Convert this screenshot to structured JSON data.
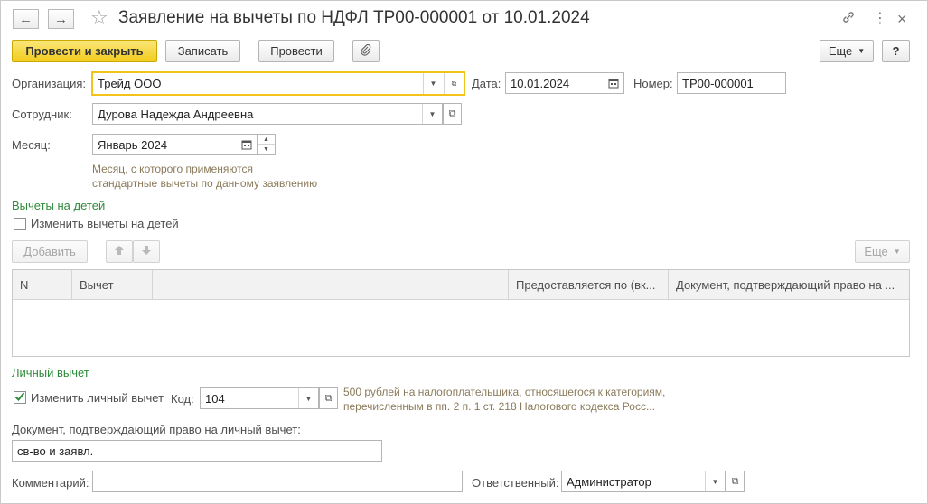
{
  "window": {
    "title": "Заявление на вычеты по НДФЛ ТР00-000001 от 10.01.2024",
    "back_icon": "←",
    "forward_icon": "→",
    "star_icon": "☆",
    "link_icon": "🔗",
    "more_icon": "⋮",
    "close_icon": "×"
  },
  "toolbar": {
    "post_close_label": "Провести и закрыть",
    "save_label": "Записать",
    "post_label": "Провести",
    "attach_icon": "📎",
    "more_label": "Еще",
    "help_label": "?"
  },
  "header": {
    "organization_label": "Организация:",
    "organization_value": "Трейд ООО",
    "date_label": "Дата:",
    "date_value": "10.01.2024",
    "number_label": "Номер:",
    "number_value": "ТР00-000001",
    "employee_label": "Сотрудник:",
    "employee_value": "Дурова Надежда Андреевна",
    "month_label": "Месяц:",
    "month_value": "Январь 2024",
    "month_hint_line1": "Месяц, с которого применяются",
    "month_hint_line2": "стандартные вычеты по данному заявлению"
  },
  "children": {
    "section_title": "Вычеты на детей",
    "change_label": "Изменить вычеты на детей",
    "change_checked": false,
    "add_label": "Добавить",
    "more_label": "Еще",
    "columns": [
      "N",
      "Вычет",
      "",
      "Предоставляется по (вк...",
      "Документ, подтверждающий право на ..."
    ]
  },
  "personal": {
    "section_title": "Личный вычет",
    "change_label": "Изменить личный вычет",
    "change_checked": true,
    "code_label": "Код:",
    "code_value": "104",
    "code_hint_line1": "500 рублей на налогоплательщика, относящегося к категориям,",
    "code_hint_line2": "перечисленным в пп. 2 п. 1 ст. 218 Налогового кодекса Росс...",
    "doc_label": "Документ, подтверждающий право на личный вычет:",
    "doc_value": "св-во и заявл."
  },
  "footer": {
    "comment_label": "Комментарий:",
    "comment_value": "",
    "responsible_label": "Ответственный:",
    "responsible_value": "Администратор"
  },
  "colors": {
    "primary_button": "#f2cc1c",
    "section_title": "#2e8b3a",
    "hint_text": "#8a7a5a",
    "focus_border": "#f2c418"
  }
}
